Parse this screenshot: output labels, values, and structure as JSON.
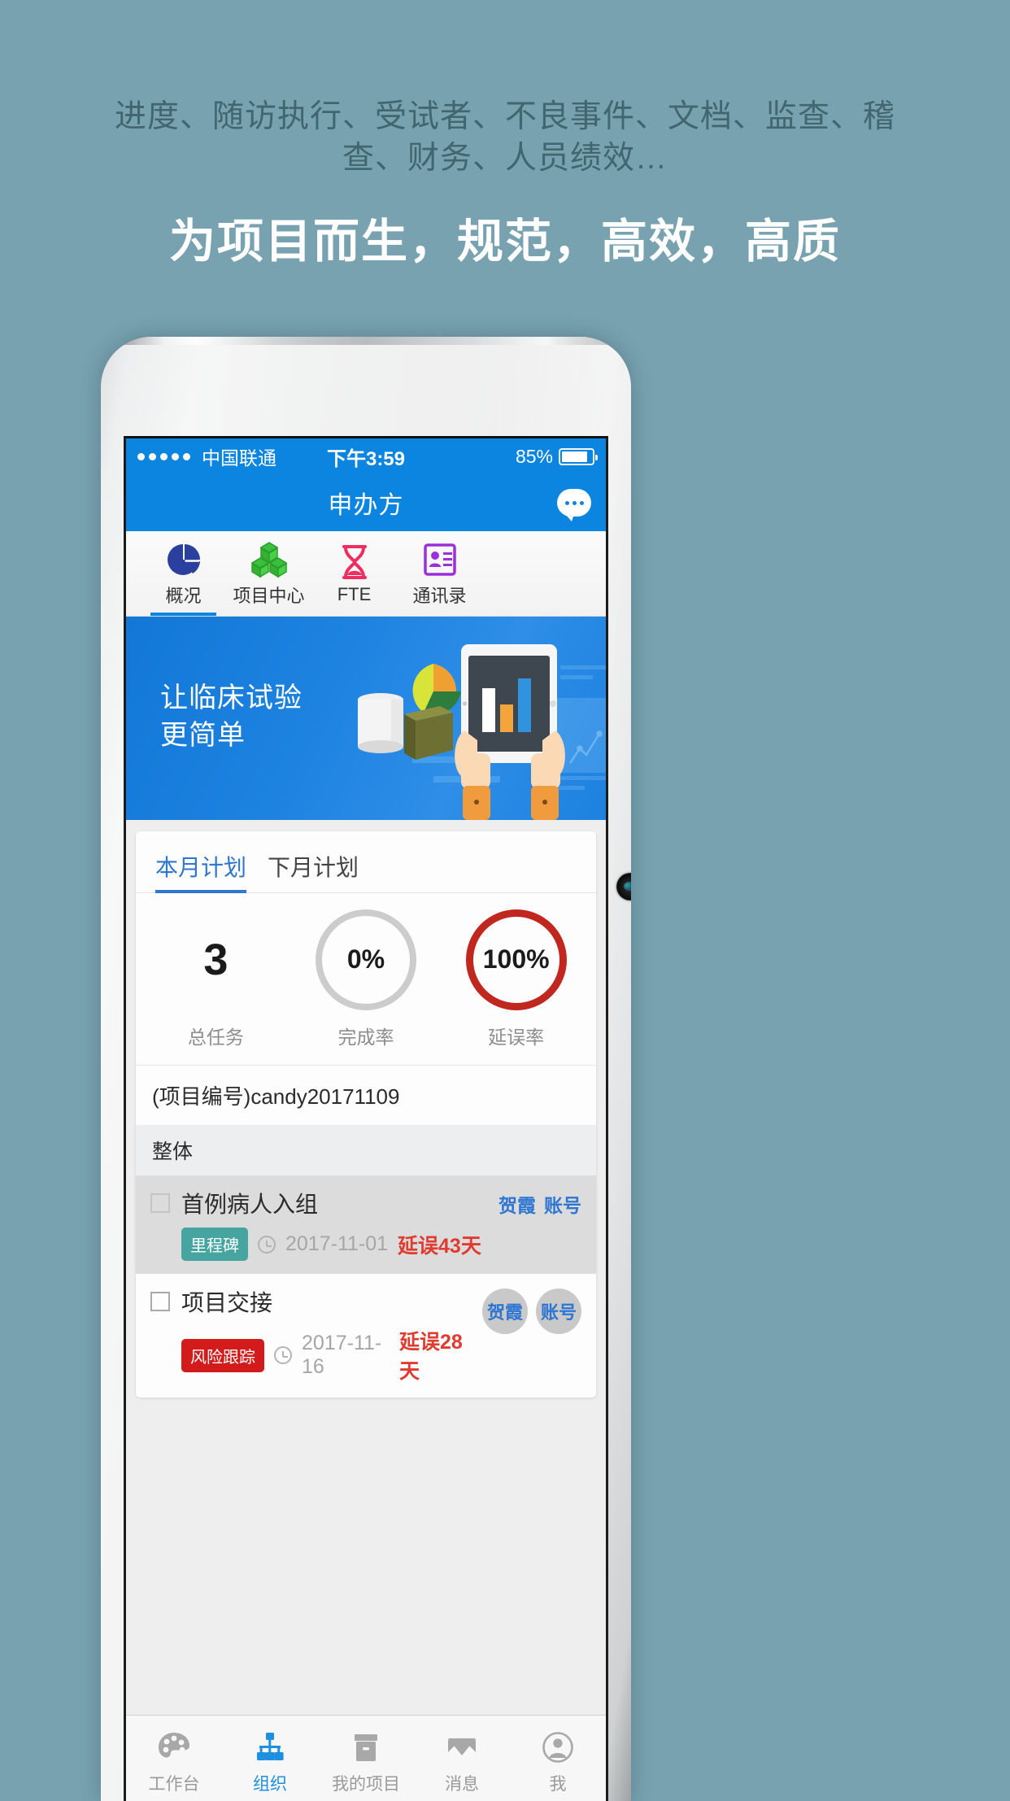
{
  "promo": {
    "subtitle": "进度、随访执行、受试者、不良事件、文档、监查、稽查、财务、人员绩效…",
    "title": "为项目而生，规范，高效，高质",
    "bg_color": "#78a2b0",
    "title_color": "#ffffff",
    "subtitle_color": "#41666f"
  },
  "statusbar": {
    "carrier": "中国联通",
    "time": "下午3:59",
    "battery_percent": "85%",
    "signal_dots": 5,
    "bg_color": "#0b85e0"
  },
  "navbar": {
    "title": "申办方",
    "chat_icon": "chat-bubble-icon"
  },
  "icon_tabs": [
    {
      "label": "概况",
      "icon": "pie-chart-icon",
      "color": "#2a3f9e",
      "active": true
    },
    {
      "label": "项目中心",
      "icon": "cubes-icon",
      "color": "#3cbf3c",
      "active": false
    },
    {
      "label": "FTE",
      "icon": "hourglass-icon",
      "color": "#ef2d5e",
      "active": false
    },
    {
      "label": "通讯录",
      "icon": "contact-card-icon",
      "color": "#9b30d9",
      "active": false
    }
  ],
  "banner": {
    "line1": "让临床试验",
    "line2": "更简单",
    "illustration": "hands-holding-tablet-with-bar-chart",
    "bg_color": "#1d82e0"
  },
  "card": {
    "tabs": [
      {
        "label": "本月计划",
        "active": true
      },
      {
        "label": "下月计划",
        "active": false
      }
    ],
    "stats": [
      {
        "value": "3",
        "caption": "总任务",
        "type": "number"
      },
      {
        "value": "0%",
        "caption": "完成率",
        "type": "ring",
        "ring_color": "#cccccc"
      },
      {
        "value": "100%",
        "caption": "延误率",
        "type": "ring",
        "ring_color": "#c0271f"
      }
    ],
    "project_label": "(项目编号)candy20171109",
    "group_header": "整体",
    "tasks": [
      {
        "title": "首例病人入组",
        "badge": "里程碑",
        "badge_color": "#46a5a0",
        "date": "2017-11-01",
        "delay": "延误43天",
        "people": [
          "贺霞",
          "账号"
        ],
        "checked": false
      },
      {
        "title": "项目交接",
        "badge": "风险跟踪",
        "badge_color": "#d31b1b",
        "date": "2017-11-16",
        "delay": "延误28天",
        "people": [
          "贺霞",
          "账号"
        ],
        "checked": false
      }
    ]
  },
  "tabbar": [
    {
      "label": "工作台",
      "icon": "palette-icon",
      "active": false
    },
    {
      "label": "组织",
      "icon": "org-chart-icon",
      "active": true
    },
    {
      "label": "我的项目",
      "icon": "box-icon",
      "active": false
    },
    {
      "label": "消息",
      "icon": "envelope-icon",
      "active": false
    },
    {
      "label": "我",
      "icon": "user-circle-icon",
      "active": false
    }
  ]
}
